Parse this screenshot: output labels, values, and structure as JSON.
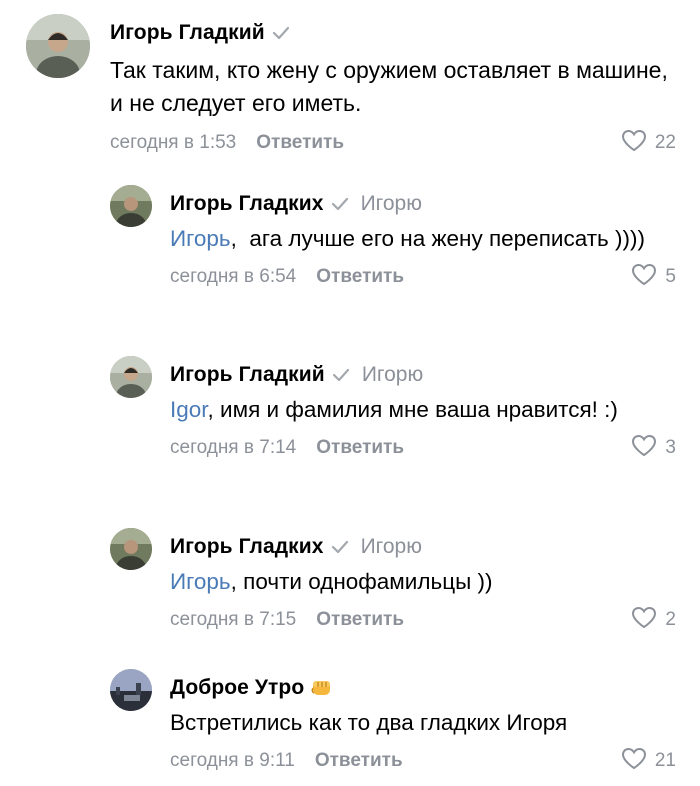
{
  "colors": {
    "mention": "#4a7bb6",
    "muted": "#8c9199",
    "emoji_fist": "#f5b83d"
  },
  "icons": {
    "verified": "checkmark-icon",
    "like": "heart-outline-icon",
    "emoji": "oncoming-fist-emoji"
  },
  "comments": [
    {
      "author": "Игорь Гладкий",
      "verified": true,
      "text": "Так таким, кто жену с оружием оставляет в машине, и не следует его иметь.",
      "time": "сегодня в 1:53",
      "reply_label": "Ответить",
      "likes": "22"
    },
    {
      "author": "Игорь Гладких",
      "verified": true,
      "reply_to": "Игорю",
      "mention": "Игорь",
      "text": ",  ага лучше его на жену переписать ))))",
      "time": "сегодня в 6:54",
      "reply_label": "Ответить",
      "likes": "5"
    },
    {
      "author": "Игорь Гладкий",
      "verified": true,
      "reply_to": "Игорю",
      "mention": "Igor",
      "text": ", имя и фамилия мне ваша нравится! :)",
      "time": "сегодня в 7:14",
      "reply_label": "Ответить",
      "likes": "3"
    },
    {
      "author": "Игорь Гладких",
      "verified": true,
      "reply_to": "Игорю",
      "mention": "Игорь",
      "text": ", почти однофамильцы ))",
      "time": "сегодня в 7:15",
      "reply_label": "Ответить",
      "likes": "2"
    },
    {
      "author": "Доброе Утро",
      "verified": false,
      "emoji": "👊",
      "text": "Встретились как то два гладких Игоря",
      "time": "сегодня в 9:11",
      "reply_label": "Ответить",
      "likes": "21"
    }
  ]
}
